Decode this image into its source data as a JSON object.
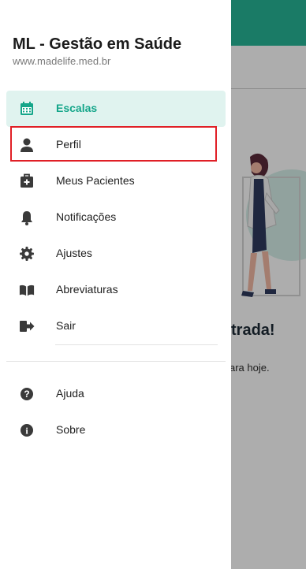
{
  "background": {
    "welcome_fragment": "trada!",
    "subtitle_fragment": "ara hoje."
  },
  "drawer": {
    "title": "ML - Gestão em Saúde",
    "url": "www.madelife.med.br",
    "items": [
      {
        "label": "Escalas",
        "icon": "calendar-icon",
        "active": true
      },
      {
        "label": "Perfil",
        "icon": "user-icon",
        "active": false
      },
      {
        "label": "Meus Pacientes",
        "icon": "medkit-icon",
        "active": false
      },
      {
        "label": "Notificações",
        "icon": "bell-icon",
        "active": false
      },
      {
        "label": "Ajustes",
        "icon": "gear-icon",
        "active": false
      },
      {
        "label": "Abreviaturas",
        "icon": "book-icon",
        "active": false
      },
      {
        "label": "Sair",
        "icon": "sign-out-icon",
        "active": false
      }
    ],
    "secondary_items": [
      {
        "label": "Ajuda",
        "icon": "question-circle-icon"
      },
      {
        "label": "Sobre",
        "icon": "info-circle-icon"
      }
    ]
  },
  "colors": {
    "accent": "#15a68a",
    "header": "#27b597",
    "active_bg": "#e0f3ef",
    "icon": "#3a3a3a",
    "highlight": "#e01f26"
  }
}
